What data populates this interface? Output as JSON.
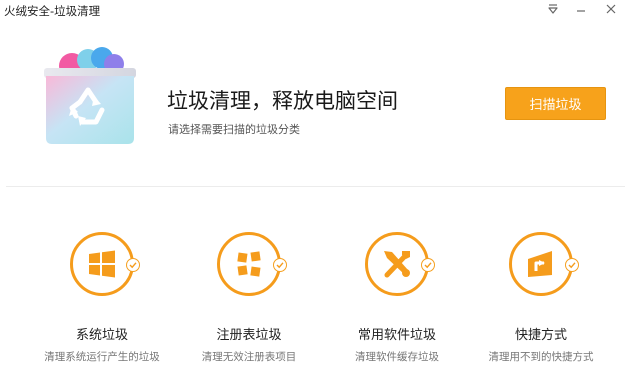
{
  "window": {
    "title": "火绒安全-垃圾清理",
    "menu_icon": "dropdown-menu-icon",
    "minimize_icon": "minimize-icon",
    "close_icon": "close-icon"
  },
  "hero": {
    "icon": "recycle-bin-icon",
    "headline": "垃圾清理，释放电脑空间",
    "subhead": "请选择需要扫描的垃圾分类",
    "scan_button": "扫描垃圾"
  },
  "categories": [
    {
      "icon": "windows-icon",
      "title": "系统垃圾",
      "desc": "清理系统运行产生的垃圾",
      "checked": true
    },
    {
      "icon": "registry-icon",
      "title": "注册表垃圾",
      "desc": "清理无效注册表项目",
      "checked": true
    },
    {
      "icon": "software-tools-icon",
      "title": "常用软件垃圾",
      "desc": "清理软件缓存垃圾",
      "checked": true
    },
    {
      "icon": "shortcut-icon",
      "title": "快捷方式",
      "desc": "清理用不到的快捷方式",
      "checked": true
    }
  ],
  "colors": {
    "accent": "#f59c1c",
    "button": "#f7a21b"
  }
}
